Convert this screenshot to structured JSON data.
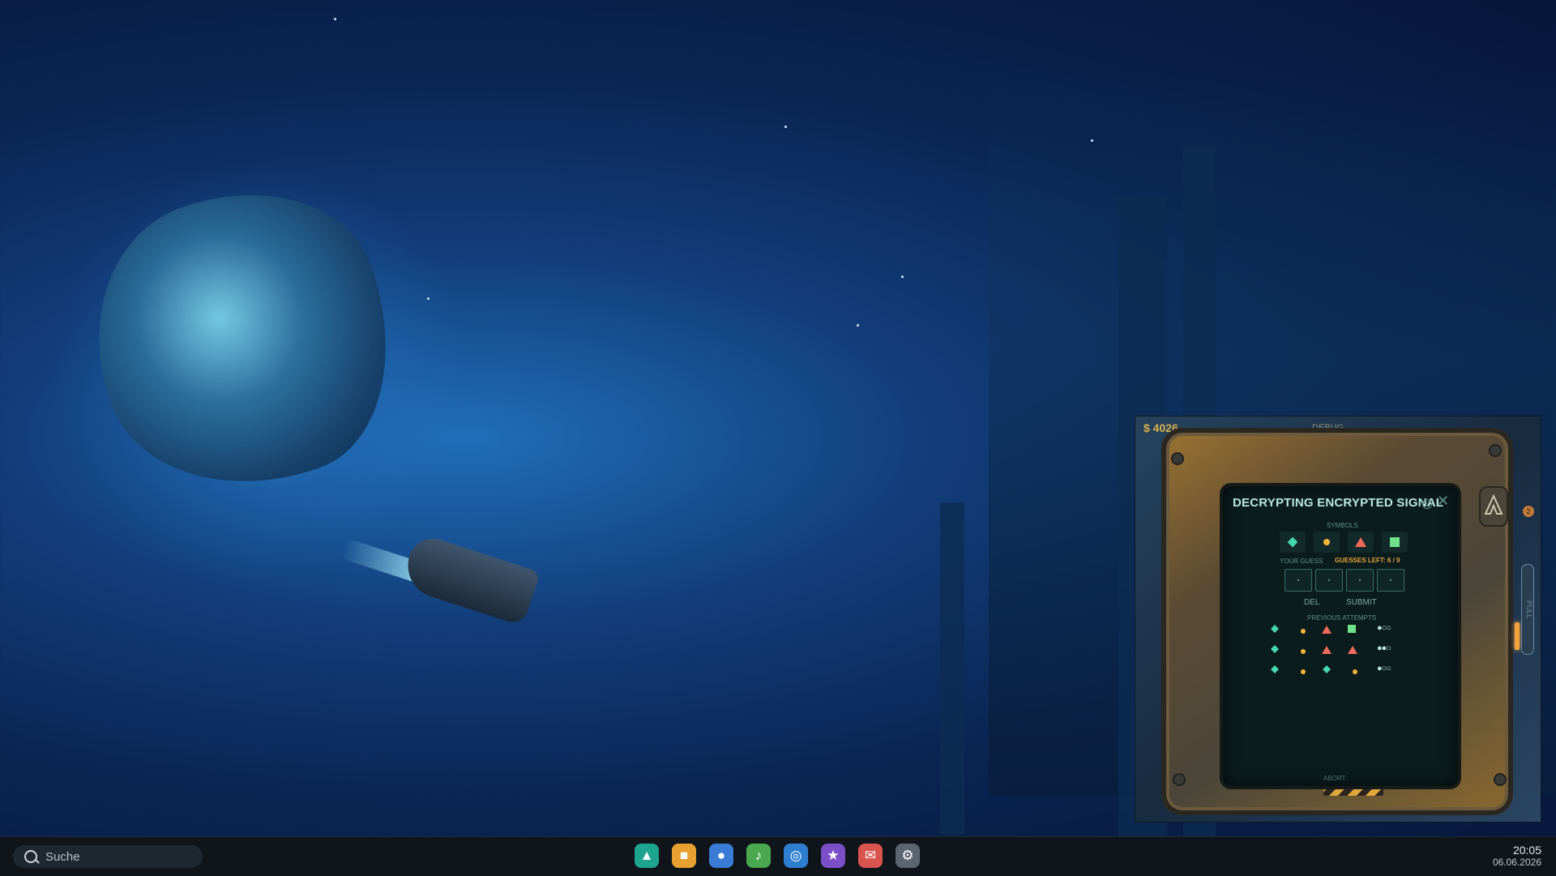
{
  "game": {
    "money": "$ 4026",
    "debug": "DEBUG",
    "title": "DECRYPTING ENCRYPTED SIGNAL",
    "info_glyph": "i",
    "close_glyph": "✕",
    "symbols_label": "SYMBOLS",
    "your_guess_label": "YOUR GUESS",
    "guesses_left": "GUESSES LEFT:  6 / 9",
    "del_label": "DEL",
    "submit_label": "SUBMIT",
    "previous_label": "PREVIOUS ATTEMPTS",
    "abort_label": "ABORT",
    "pull_label": "PULL",
    "badge": "2",
    "symbols": [
      "diamond",
      "circle",
      "triangle",
      "square"
    ],
    "attempts": [
      {
        "symbols": [
          "diamond",
          "circle",
          "triangle",
          "square"
        ],
        "feedback": "●○○"
      },
      {
        "symbols": [
          "diamond",
          "circle",
          "triangle",
          "triangle"
        ],
        "feedback": "●●○"
      },
      {
        "symbols": [
          "diamond",
          "circle",
          "diamond",
          "circle"
        ],
        "feedback": "●○○"
      }
    ],
    "colors": {
      "diamond": "#46d7b0",
      "circle": "#f4b43a",
      "triangle": "#f06a5a",
      "square": "#6ee08a"
    }
  },
  "taskbar": {
    "search_placeholder": "Suche",
    "time": "20:05",
    "date": "06.06.2026",
    "apps": [
      {
        "name": "launcher-icon",
        "glyph": "▲",
        "color": "#1ea58f"
      },
      {
        "name": "files-icon",
        "glyph": "■",
        "color": "#e8a131"
      },
      {
        "name": "chat-icon",
        "glyph": "●",
        "color": "#3a7bd5"
      },
      {
        "name": "music-icon",
        "glyph": "♪",
        "color": "#4aa84f"
      },
      {
        "name": "browser-icon",
        "glyph": "◎",
        "color": "#2f7fd0"
      },
      {
        "name": "favorites-icon",
        "glyph": "★",
        "color": "#7a4fc8"
      },
      {
        "name": "mail-icon",
        "glyph": "✉",
        "color": "#d9534f"
      },
      {
        "name": "settings-icon",
        "glyph": "⚙",
        "color": "#5b6470"
      }
    ]
  }
}
